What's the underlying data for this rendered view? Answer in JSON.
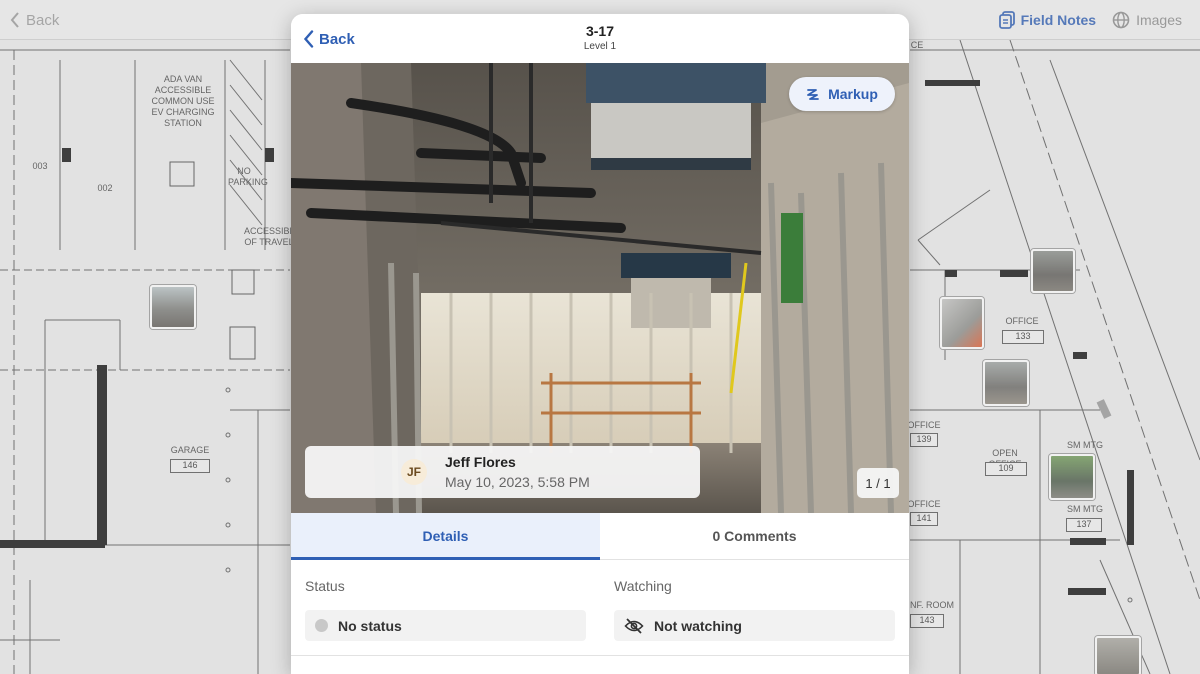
{
  "background": {
    "back_label": "Back",
    "tabs": [
      {
        "label": "Field Notes",
        "active": true,
        "icon": "notes-icon"
      },
      {
        "label": "Images",
        "active": false,
        "icon": "globe-icon"
      }
    ],
    "blueprint_labels": {
      "ada": "ADA VAN ACCESSIBLE COMMON USE EV CHARGING STATION",
      "no_parking": "NO PARKING",
      "accessible": "ACCESSIBLE OF TRAVEL",
      "garage": "GARAGE",
      "garage_num": "146",
      "space_003": "003",
      "space_002": "002",
      "office_133": "OFFICE",
      "num_133": "133",
      "office_139": "OFFICE",
      "num_139": "139",
      "open_office": "OPEN OFFICE",
      "num_109": "109",
      "sm_mtg_1": "SM MTG",
      "sm_mtg_2": "SM MTG",
      "num_137": "137",
      "office_141": "OFFICE",
      "num_141": "141",
      "conf_room": "NF. ROOM",
      "num_143": "143",
      "ce": "CE"
    }
  },
  "modal": {
    "back_label": "Back",
    "title": "3-17",
    "subtitle": "Level 1",
    "markup_label": "Markup",
    "author": {
      "initials": "JF",
      "name": "Jeff Flores",
      "date": "May 10, 2023, 5:58 PM"
    },
    "page_counter": "1 / 1",
    "tabs": [
      {
        "label": "Details",
        "active": true
      },
      {
        "label": "0 Comments",
        "active": false
      }
    ],
    "status": {
      "label": "Status",
      "value": "No status"
    },
    "watching": {
      "label": "Watching",
      "value": "Not watching",
      "icon": "eye-off-icon"
    }
  },
  "colors": {
    "accent": "#2f5fb4",
    "tab_active_bg": "#eaf0fb"
  }
}
